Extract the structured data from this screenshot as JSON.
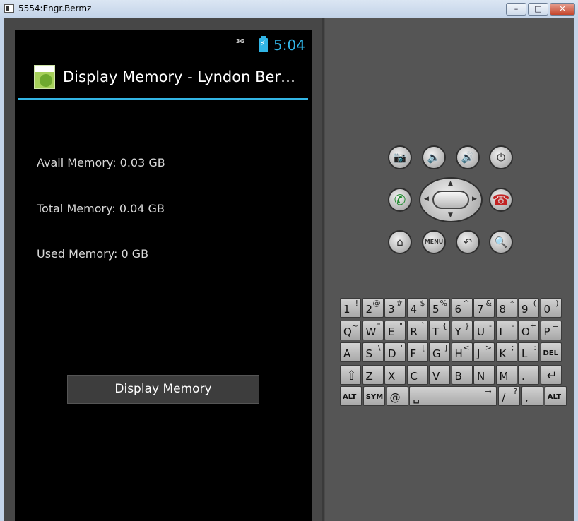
{
  "window": {
    "title": "5554:Engr.Bermz",
    "min_label": "–",
    "max_label": "□",
    "close_label": "✕"
  },
  "status_bar": {
    "network": "3G",
    "time": "5:04"
  },
  "app": {
    "title": "Display Memory - Lyndon Ber…",
    "avail_memory": "Avail Memory: 0.03 GB",
    "total_memory": "Total Memory: 0.04 GB",
    "used_memory": "Used Memory: 0 GB",
    "display_button": "Display Memory"
  },
  "hardware_buttons": {
    "menu_label": "MENU"
  },
  "keyboard": {
    "rows": [
      [
        {
          "main": "1",
          "alt": "!"
        },
        {
          "main": "2",
          "alt": "@"
        },
        {
          "main": "3",
          "alt": "#"
        },
        {
          "main": "4",
          "alt": "$"
        },
        {
          "main": "5",
          "alt": "%"
        },
        {
          "main": "6",
          "alt": "^"
        },
        {
          "main": "7",
          "alt": "&"
        },
        {
          "main": "8",
          "alt": "*"
        },
        {
          "main": "9",
          "alt": "("
        },
        {
          "main": "0",
          "alt": ")"
        }
      ],
      [
        {
          "main": "Q",
          "alt": "~"
        },
        {
          "main": "W",
          "alt": "\""
        },
        {
          "main": "E",
          "alt": "\""
        },
        {
          "main": "R",
          "alt": "`"
        },
        {
          "main": "T",
          "alt": "{"
        },
        {
          "main": "Y",
          "alt": "}"
        },
        {
          "main": "U",
          "alt": "-"
        },
        {
          "main": "I",
          "alt": "-"
        },
        {
          "main": "O",
          "alt": "+"
        },
        {
          "main": "P",
          "alt": "="
        }
      ],
      [
        {
          "main": "A",
          "alt": ""
        },
        {
          "main": "S",
          "alt": "\\"
        },
        {
          "main": "D",
          "alt": "'"
        },
        {
          "main": "F",
          "alt": "["
        },
        {
          "main": "G",
          "alt": "]"
        },
        {
          "main": "H",
          "alt": "<"
        },
        {
          "main": "J",
          "alt": ">"
        },
        {
          "main": "K",
          "alt": ";"
        },
        {
          "main": "L",
          "alt": ":"
        },
        {
          "main": "DEL",
          "alt": ""
        }
      ],
      [
        {
          "main": "⇧",
          "alt": ""
        },
        {
          "main": "Z",
          "alt": ""
        },
        {
          "main": "X",
          "alt": ""
        },
        {
          "main": "C",
          "alt": ""
        },
        {
          "main": "V",
          "alt": ""
        },
        {
          "main": "B",
          "alt": ""
        },
        {
          "main": "N",
          "alt": ""
        },
        {
          "main": "M",
          "alt": ""
        },
        {
          "main": ".",
          "alt": ""
        },
        {
          "main": "↵",
          "alt": ""
        }
      ],
      [
        {
          "main": "ALT",
          "alt": ""
        },
        {
          "main": "SYM",
          "alt": ""
        },
        {
          "main": "@",
          "alt": ""
        },
        {
          "main": "␣",
          "alt": "→|"
        },
        {
          "main": "/",
          "alt": "?"
        },
        {
          "main": ",",
          "alt": ""
        },
        {
          "main": "ALT",
          "alt": ""
        }
      ]
    ]
  },
  "colors": {
    "accent": "#33b5e5",
    "screen_bg": "#000000",
    "skin_bg": "#4a4a4a"
  }
}
